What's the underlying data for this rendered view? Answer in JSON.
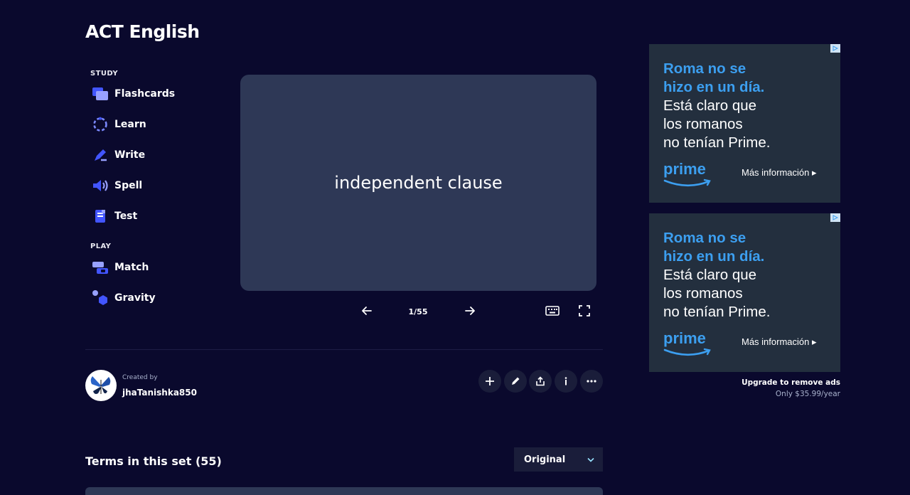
{
  "set_title": "ACT English",
  "nav": {
    "study_label": "STUDY",
    "play_label": "PLAY",
    "study_items": [
      {
        "label": "Flashcards",
        "icon": "flashcards-icon"
      },
      {
        "label": "Learn",
        "icon": "learn-icon"
      },
      {
        "label": "Write",
        "icon": "write-icon"
      },
      {
        "label": "Spell",
        "icon": "spell-icon"
      },
      {
        "label": "Test",
        "icon": "test-icon"
      }
    ],
    "play_items": [
      {
        "label": "Match",
        "icon": "match-icon"
      },
      {
        "label": "Gravity",
        "icon": "gravity-icon"
      }
    ]
  },
  "flashcard": {
    "term": "independent clause",
    "counter": "1/55"
  },
  "creator": {
    "created_by_label": "Created by",
    "username": "jhaTanishka850"
  },
  "terms": {
    "heading": "Terms in this set (55)",
    "sort_value": "Original"
  },
  "ads": [
    {
      "headline_1": "Roma no se",
      "headline_2": "hizo en un día.",
      "body_1": "Está claro que",
      "body_2": "los romanos",
      "body_3": "no tenían Prime.",
      "logo": "prime",
      "cta": "Más información ▸"
    },
    {
      "headline_1": "Roma no se",
      "headline_2": "hizo en un día.",
      "body_1": "Está claro que",
      "body_2": "los romanos",
      "body_3": "no tenían Prime.",
      "logo": "prime",
      "cta": "Más información ▸"
    }
  ],
  "upgrade": {
    "line": "Upgrade to remove ads",
    "price": "Only $35.99/year"
  },
  "colors": {
    "background": "#0a092d",
    "card": "#2e3856",
    "accent": "#4255ff",
    "ad_blue": "#3c9ff0"
  }
}
